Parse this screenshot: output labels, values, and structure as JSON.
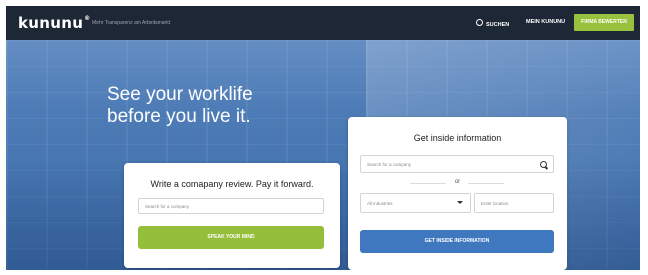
{
  "navbar": {
    "logo": "kununu",
    "logo_mark": "®",
    "tagline": "Mehr Transparenz am Arbeitsmarkt",
    "search_label": "SUCHEN",
    "my_kununu_label": "MEIN KUNUNU",
    "rate_button_label": "FIRMA BEWERTEN"
  },
  "hero": {
    "headline_line1": "See your worklife",
    "headline_line2": "before you live it."
  },
  "review_card": {
    "title": "Write a comapany review. Pay it forward.",
    "search_placeholder": "Search for a company",
    "button_label": "SPEAK YOUR MIND"
  },
  "info_card": {
    "title": "Get inside information",
    "search_placeholder": "Search for a company",
    "or_label": "or",
    "industry_select": "All industries",
    "location_placeholder": "Enter location",
    "button_label": "GET INSIDE INFORMATION"
  },
  "colors": {
    "navbar": "#1e2735",
    "green_accent": "#95bf3b",
    "blue_accent": "#3f78bf"
  }
}
